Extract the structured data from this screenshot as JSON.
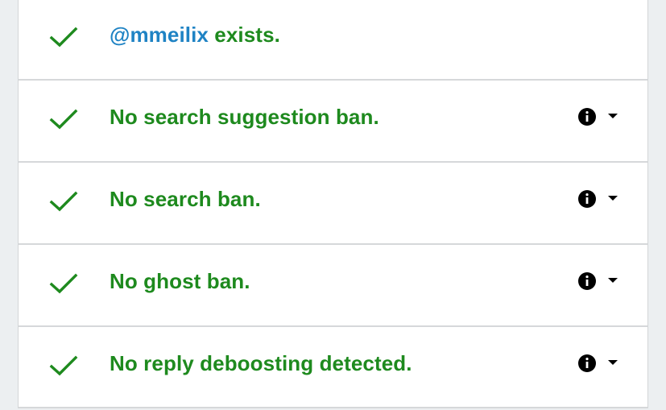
{
  "colors": {
    "success_green": "#1e8a1e",
    "handle_blue": "#1f83c4",
    "divider": "#d6d8da",
    "background": "#eceff1"
  },
  "rows": [
    {
      "status_icon": "check-icon",
      "handle": "@mmeilix",
      "text": " exists.",
      "has_info": false
    },
    {
      "status_icon": "check-icon",
      "text": "No search suggestion ban.",
      "has_info": true,
      "info_icon": "info-icon",
      "toggle_icon": "caret-down-icon"
    },
    {
      "status_icon": "check-icon",
      "text": "No search ban.",
      "has_info": true,
      "info_icon": "info-icon",
      "toggle_icon": "caret-down-icon"
    },
    {
      "status_icon": "check-icon",
      "text": "No ghost ban.",
      "has_info": true,
      "info_icon": "info-icon",
      "toggle_icon": "caret-down-icon"
    },
    {
      "status_icon": "check-icon",
      "text": "No reply deboosting detected.",
      "has_info": true,
      "info_icon": "info-icon",
      "toggle_icon": "caret-down-icon"
    }
  ]
}
